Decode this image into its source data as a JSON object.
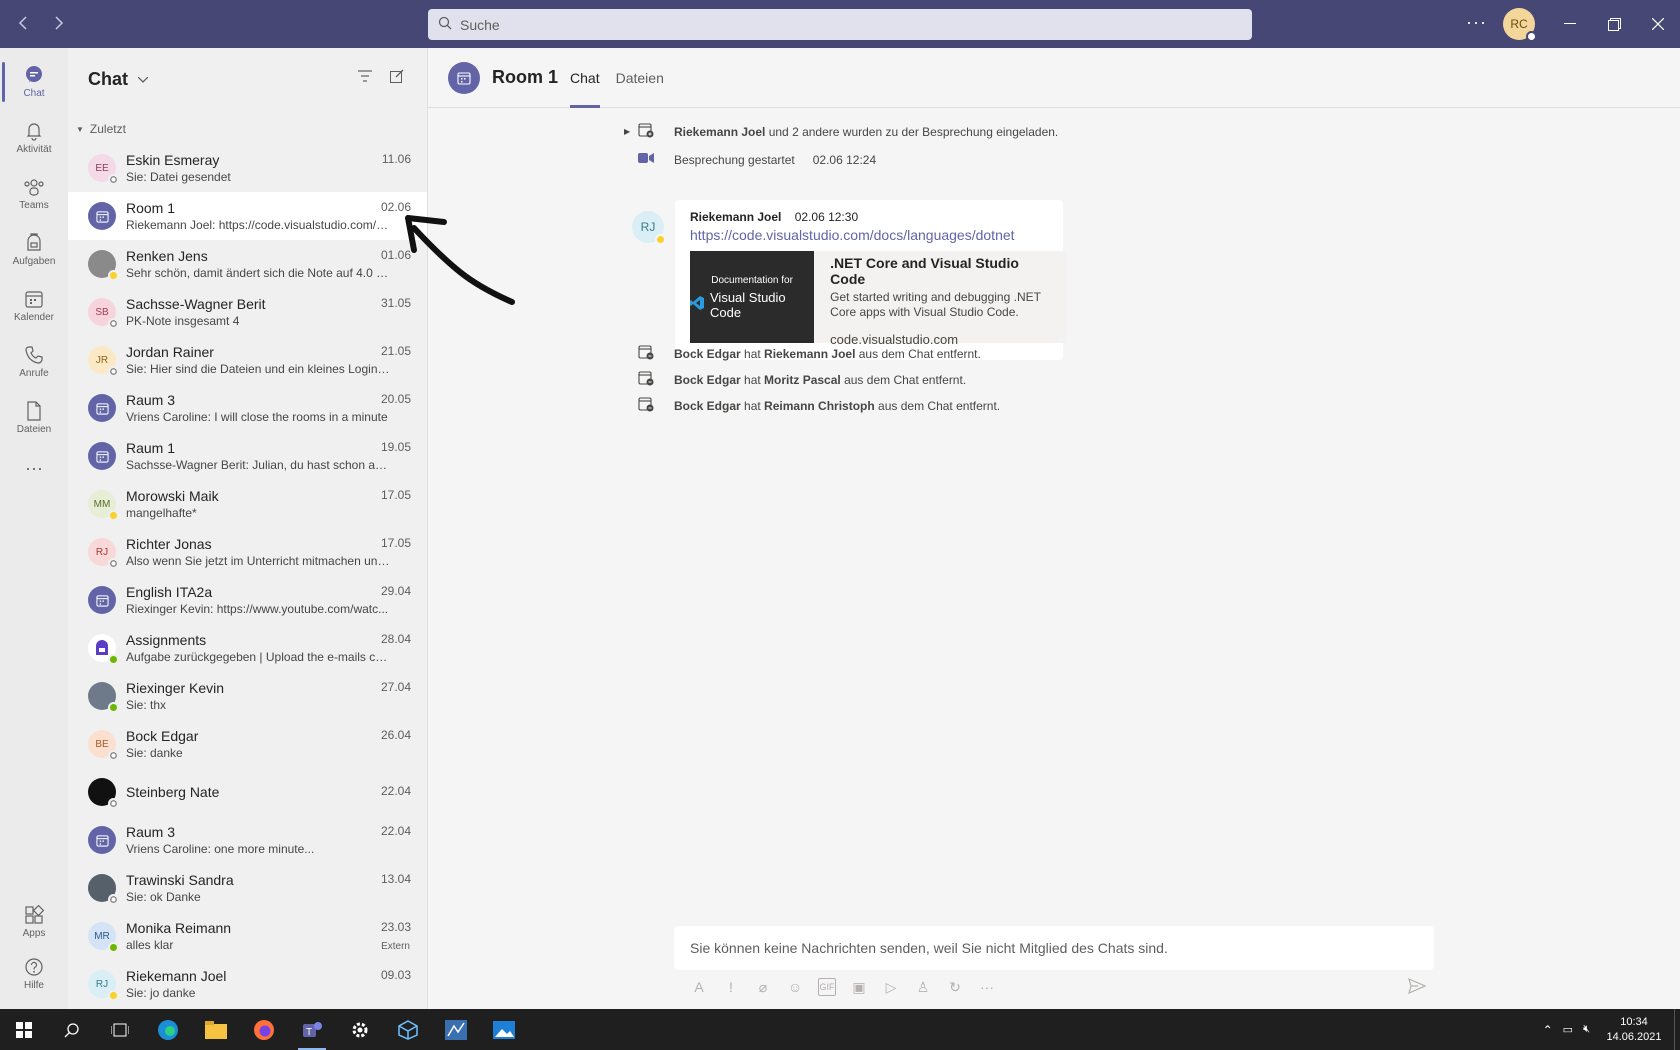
{
  "titlebar": {
    "search_placeholder": "Suche",
    "user_initials": "RC"
  },
  "rail": [
    {
      "label": "Chat",
      "icon": "chat-icon",
      "active": true
    },
    {
      "label": "Aktivität",
      "icon": "bell-icon"
    },
    {
      "label": "Teams",
      "icon": "teams-icon"
    },
    {
      "label": "Aufgaben",
      "icon": "assignments-icon"
    },
    {
      "label": "Kalender",
      "icon": "calendar-icon"
    },
    {
      "label": "Anrufe",
      "icon": "phone-icon"
    },
    {
      "label": "Dateien",
      "icon": "file-icon"
    },
    {
      "label": "Apps",
      "icon": "apps-icon"
    },
    {
      "label": "Hilfe",
      "icon": "help-icon"
    }
  ],
  "chatlist": {
    "title": "Chat",
    "section": "Zuletzt",
    "items": [
      {
        "name": "Eskin Esmeray",
        "time": "11.06",
        "preview": "Sie: Datei gesendet",
        "initials": "EE",
        "type": "person",
        "status": "off",
        "bg": "#f4d9e6",
        "fg": "#8a3b62"
      },
      {
        "name": "Room 1",
        "time": "02.06",
        "preview": "Riekemann Joel: https://code.visualstudio.com/d...",
        "type": "meeting",
        "selected": true
      },
      {
        "name": "Renken Jens",
        "time": "01.06",
        "preview": "Sehr schön, damit ändert sich die Note auf 4.0 al...",
        "initials": "",
        "type": "photo",
        "status": "away",
        "bg": "#8a8a8a",
        "fg": "#fff"
      },
      {
        "name": "Sachsse-Wagner Berit",
        "time": "31.05",
        "preview": "PK-Note insgesamt 4",
        "initials": "SB",
        "type": "person",
        "status": "off",
        "bg": "#f7d4dc",
        "fg": "#a33b55"
      },
      {
        "name": "Jordan Rainer",
        "time": "21.05",
        "preview": "Sie: Hier sind die Dateien und ein kleines Login S...",
        "initials": "JR",
        "type": "person",
        "status": "off",
        "bg": "#fbe9c5",
        "fg": "#8a6514"
      },
      {
        "name": "Raum 3",
        "time": "20.05",
        "preview": "Vriens Caroline: I will close the rooms in a minute",
        "type": "meeting"
      },
      {
        "name": "Raum 1",
        "time": "19.05",
        "preview": "Sachsse-Wagner Berit: Julian, du hast schon abg...",
        "type": "meeting"
      },
      {
        "name": "Morowski Maik",
        "time": "17.05",
        "preview": "mangelhafte*",
        "initials": "MM",
        "type": "person",
        "status": "away",
        "bg": "#e7eed6",
        "fg": "#5b6b2b"
      },
      {
        "name": "Richter Jonas",
        "time": "17.05",
        "preview": "Also wenn Sie jetzt im Unterricht mitmachen und...",
        "initials": "RJ",
        "type": "person",
        "status": "off",
        "bg": "#f8d8d8",
        "fg": "#a33b3b"
      },
      {
        "name": "English ITA2a",
        "time": "29.04",
        "preview": "Riexinger Kevin: https://www.youtube.com/watc...",
        "type": "meeting"
      },
      {
        "name": "Assignments",
        "time": "28.04",
        "preview": "Aufgabe zurückgegeben | Upload the e-mails co...",
        "type": "app",
        "status": "avail"
      },
      {
        "name": "Riexinger Kevin",
        "time": "27.04",
        "preview": "Sie: thx",
        "initials": "",
        "type": "photo",
        "status": "avail",
        "bg": "#6e7a8a",
        "fg": "#fff"
      },
      {
        "name": "Bock Edgar",
        "time": "26.04",
        "preview": "Sie: danke",
        "initials": "BE",
        "type": "person",
        "status": "off",
        "bg": "#fbe0cf",
        "fg": "#a35a2a"
      },
      {
        "name": "Steinberg Nate",
        "time": "22.04",
        "preview": "",
        "initials": "",
        "type": "photo",
        "status": "off",
        "bg": "#111111",
        "fg": "#fff"
      },
      {
        "name": "Raum 3",
        "time": "22.04",
        "preview": "Vriens Caroline: one more minute...",
        "type": "meeting"
      },
      {
        "name": "Trawinski Sandra",
        "time": "13.04",
        "preview": "Sie: ok Danke",
        "initials": "",
        "type": "photo",
        "status": "off",
        "bg": "#55606b",
        "fg": "#fff"
      },
      {
        "name": "Monika Reimann",
        "time": "23.03",
        "preview": "alles klar",
        "initials": "MR",
        "type": "person",
        "status": "avail",
        "bg": "#d4e3f5",
        "fg": "#2b5a8a",
        "extern": "Extern"
      },
      {
        "name": "Riekemann Joel",
        "time": "09.03",
        "preview": "Sie: jo danke",
        "initials": "RJ",
        "type": "person",
        "status": "away",
        "bg": "#d9eef5",
        "fg": "#3a7a8c"
      }
    ]
  },
  "main": {
    "title": "Room 1",
    "tabs": [
      "Chat",
      "Dateien"
    ],
    "sys1": {
      "bold": "Riekemann Joel",
      "rest": " und 2 andere wurden zu der Besprechung eingeladen."
    },
    "sys2": {
      "text": "Besprechung gestartet",
      "time": "02.06 12:24"
    },
    "message": {
      "initials": "RJ",
      "author": "Riekemann Joel",
      "time": "02.06 12:30",
      "link": "https://code.visualstudio.com/docs/languages/dotnet",
      "preview_img_line1": "Documentation for",
      "preview_img_line2": "Visual Studio Code",
      "preview_title": ".NET Core and Visual Studio Code",
      "preview_desc": "Get started writing and debugging .NET Core apps with Visual Studio Code.",
      "preview_domain": "code.visualstudio.com"
    },
    "removed": [
      {
        "actor": "Bock Edgar",
        "hat": " hat ",
        "target": "Riekemann Joel",
        "rest": " aus dem Chat entfernt."
      },
      {
        "actor": "Bock Edgar",
        "hat": " hat ",
        "target": "Moritz Pascal",
        "rest": " aus dem Chat entfernt."
      },
      {
        "actor": "Bock Edgar",
        "hat": " hat ",
        "target": "Reimann Christoph",
        "rest": " aus dem Chat entfernt."
      }
    ],
    "compose_text": "Sie können keine Nachrichten senden, weil Sie nicht Mitglied des Chats sind."
  },
  "taskbar": {
    "time": "10:34",
    "date": "14.06.2021"
  },
  "colors": {
    "accent": "#6264a7",
    "titlebar": "#464775"
  }
}
